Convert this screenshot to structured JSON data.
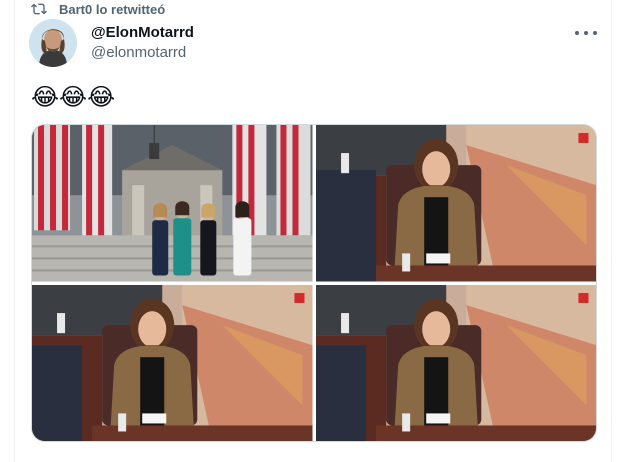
{
  "retweet": {
    "label": "Bart0 lo retwitteó",
    "icon": "retweet-icon"
  },
  "author": {
    "display_name": "@ElonMotarrd",
    "handle": "@elonmotarrd",
    "avatar": "avatar"
  },
  "tweet": {
    "text": "😂😂😂"
  },
  "media": [
    {
      "name": "photo-group-on-steps",
      "alt": ""
    },
    {
      "name": "photo-woman-at-desk-1",
      "alt": ""
    },
    {
      "name": "photo-woman-at-desk-2",
      "alt": ""
    },
    {
      "name": "photo-woman-at-desk-3",
      "alt": ""
    }
  ],
  "colors": {
    "text": "#0f1419",
    "muted": "#536471",
    "border": "#cfd9de"
  }
}
